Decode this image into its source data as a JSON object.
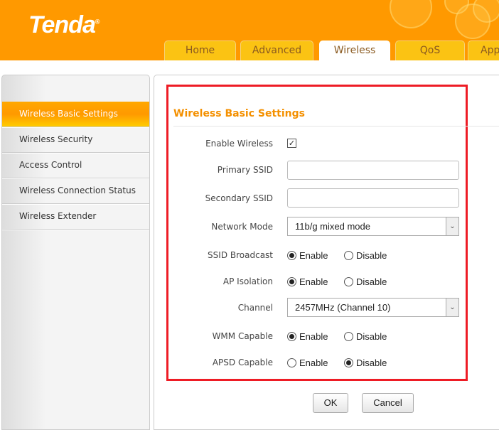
{
  "brand": {
    "logo": "Tenda"
  },
  "tabs": [
    {
      "label": "Home"
    },
    {
      "label": "Advanced"
    },
    {
      "label": "Wireless"
    },
    {
      "label": "QoS"
    },
    {
      "label": "App"
    }
  ],
  "sidebar": {
    "items": [
      {
        "label": "Wireless Basic Settings"
      },
      {
        "label": "Wireless Security"
      },
      {
        "label": "Access Control"
      },
      {
        "label": "Wireless Connection Status"
      },
      {
        "label": "Wireless Extender"
      }
    ]
  },
  "form": {
    "title": "Wireless Basic Settings",
    "enable_wireless": {
      "label": "Enable Wireless",
      "checked": true,
      "mark": "✓"
    },
    "primary_ssid": {
      "label": "Primary SSID",
      "value": ""
    },
    "secondary_ssid": {
      "label": "Secondary SSID",
      "value": ""
    },
    "network_mode": {
      "label": "Network Mode",
      "value": "11b/g mixed mode"
    },
    "ssid_broadcast": {
      "label": "SSID Broadcast",
      "selected": "Enable"
    },
    "ap_isolation": {
      "label": "AP Isolation",
      "selected": "Enable"
    },
    "channel": {
      "label": "Channel",
      "value": "2457MHz (Channel 10)"
    },
    "wmm": {
      "label": "WMM Capable",
      "selected": "Enable"
    },
    "apsd": {
      "label": "APSD Capable",
      "selected": "Disable"
    },
    "opt_enable": "Enable",
    "opt_disable": "Disable",
    "arrow": "⌄"
  },
  "buttons": {
    "ok": "OK",
    "cancel": "Cancel"
  },
  "colors": {
    "header": "#ff9900",
    "tab": "#fbc313",
    "highlight": "#ee1c25",
    "title": "#f49000"
  }
}
